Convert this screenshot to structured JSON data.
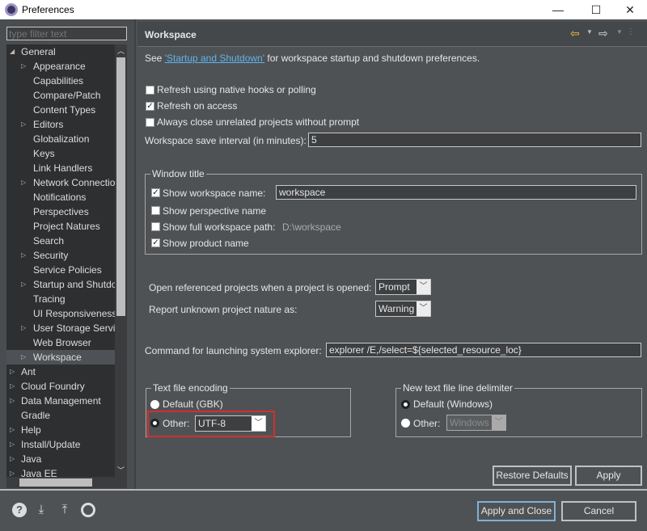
{
  "window": {
    "title": "Preferences",
    "minimize": "—",
    "maximize": "☐",
    "close": "✕"
  },
  "filter": {
    "placeholder": "type filter text"
  },
  "tree": [
    {
      "label": "General",
      "level": 0,
      "expanded": true
    },
    {
      "label": "Appearance",
      "level": 1,
      "expandable": true
    },
    {
      "label": "Capabilities",
      "level": 1
    },
    {
      "label": "Compare/Patch",
      "level": 1
    },
    {
      "label": "Content Types",
      "level": 1
    },
    {
      "label": "Editors",
      "level": 1,
      "expandable": true
    },
    {
      "label": "Globalization",
      "level": 1
    },
    {
      "label": "Keys",
      "level": 1
    },
    {
      "label": "Link Handlers",
      "level": 1
    },
    {
      "label": "Network Connections",
      "level": 1,
      "expandable": true
    },
    {
      "label": "Notifications",
      "level": 1
    },
    {
      "label": "Perspectives",
      "level": 1
    },
    {
      "label": "Project Natures",
      "level": 1
    },
    {
      "label": "Search",
      "level": 1
    },
    {
      "label": "Security",
      "level": 1,
      "expandable": true
    },
    {
      "label": "Service Policies",
      "level": 1
    },
    {
      "label": "Startup and Shutdown",
      "level": 1,
      "expandable": true
    },
    {
      "label": "Tracing",
      "level": 1
    },
    {
      "label": "UI Responsiveness",
      "level": 1
    },
    {
      "label": "User Storage Service",
      "level": 1,
      "expandable": true
    },
    {
      "label": "Web Browser",
      "level": 1
    },
    {
      "label": "Workspace",
      "level": 1,
      "expandable": true,
      "selected": true
    },
    {
      "label": "Ant",
      "level": 0,
      "expandable": true
    },
    {
      "label": "Cloud Foundry",
      "level": 0,
      "expandable": true
    },
    {
      "label": "Data Management",
      "level": 0,
      "expandable": true
    },
    {
      "label": "Gradle",
      "level": 0
    },
    {
      "label": "Help",
      "level": 0,
      "expandable": true
    },
    {
      "label": "Install/Update",
      "level": 0,
      "expandable": true
    },
    {
      "label": "Java",
      "level": 0,
      "expandable": true
    },
    {
      "label": "Java EE",
      "level": 0,
      "expandable": true
    }
  ],
  "page": {
    "title": "Workspace",
    "intro_prefix": "See ",
    "intro_link": "'Startup and Shutdown'",
    "intro_suffix": " for workspace startup and shutdown preferences.",
    "options": [
      {
        "label": "Refresh using native hooks or polling",
        "checked": false
      },
      {
        "label": "Refresh on access",
        "checked": true
      },
      {
        "label": "Always close unrelated projects without prompt",
        "checked": false
      }
    ],
    "save_interval_label": "Workspace save interval (in minutes):",
    "save_interval_value": "5",
    "window_title": {
      "legend": "Window title",
      "show_workspace_name": {
        "label": "Show workspace name:",
        "checked": true,
        "value": "workspace"
      },
      "show_perspective_name": {
        "label": "Show perspective name",
        "checked": false
      },
      "show_full_path": {
        "label": "Show full workspace path:",
        "checked": false,
        "value": "D:\\workspace"
      },
      "show_product_name": {
        "label": "Show product name",
        "checked": true
      }
    },
    "open_referenced_label": "Open referenced projects when a project is opened:",
    "open_referenced_value": "Prompt",
    "unknown_nature_label": "Report unknown project nature as:",
    "unknown_nature_value": "Warning",
    "explorer_label": "Command for launching system explorer:",
    "explorer_value": "explorer /E,/select=${selected_resource_loc}",
    "encoding": {
      "legend": "Text file encoding",
      "default_label": "Default (GBK)",
      "other_label": "Other:",
      "other_value": "UTF-8",
      "selected": "other"
    },
    "delimiter": {
      "legend": "New text file line delimiter",
      "default_label": "Default (Windows)",
      "other_label": "Other:",
      "other_value": "Windows",
      "selected": "default"
    },
    "restore_defaults": "Restore Defaults",
    "apply": "Apply"
  },
  "footer": {
    "apply_close": "Apply and Close",
    "cancel": "Cancel",
    "icons": [
      "help-icon",
      "import-icon",
      "export-icon",
      "oomph-icon"
    ]
  },
  "highlight_color": "#d32f2f"
}
